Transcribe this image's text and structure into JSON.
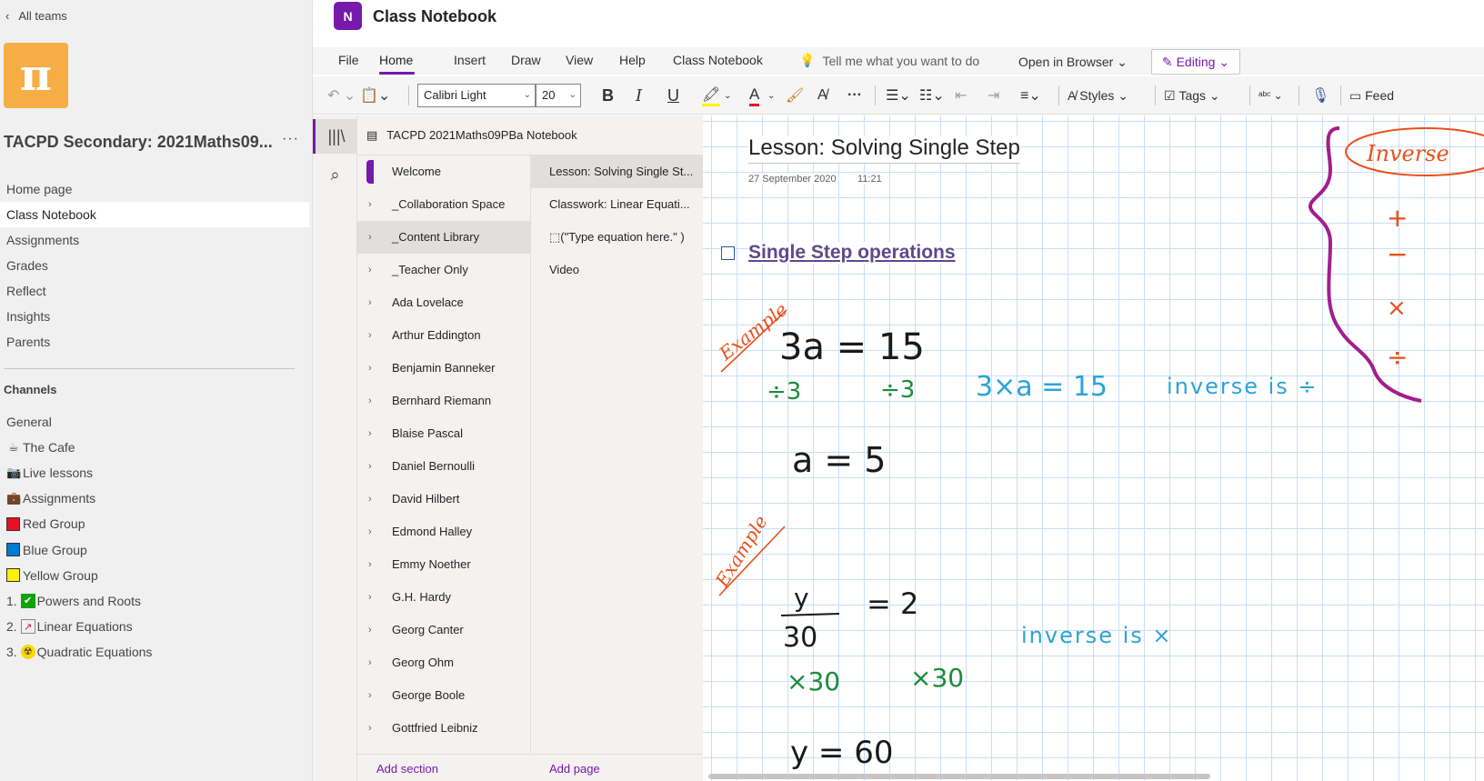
{
  "teams_pane": {
    "back_label": "All teams",
    "team_name": "TACPD Secondary: 2021Maths09...",
    "more": "···",
    "logo_symbol": "π",
    "nav": [
      "Home page",
      "Class Notebook",
      "Assignments",
      "Grades",
      "Reflect",
      "Insights",
      "Parents"
    ],
    "active_nav": "Class Notebook",
    "channels_heading": "Channels",
    "channels": [
      {
        "prefix": "",
        "icon": "",
        "label": "General"
      },
      {
        "prefix": "",
        "icon": "coffee-cup-icon",
        "label": "The Cafe"
      },
      {
        "prefix": "",
        "icon": "camera-icon",
        "label": "Live lessons"
      },
      {
        "prefix": "",
        "icon": "briefcase-icon",
        "label": "Assignments"
      },
      {
        "prefix": "",
        "icon": "red-square-icon",
        "label": "Red Group",
        "color": "#e81123"
      },
      {
        "prefix": "",
        "icon": "blue-square-icon",
        "label": "Blue Group",
        "color": "#0078d4"
      },
      {
        "prefix": "",
        "icon": "yellow-square-icon",
        "label": "Yellow Group",
        "color": "#fff100"
      },
      {
        "prefix": "1.",
        "icon": "check-box-icon",
        "label": "Powers and Roots"
      },
      {
        "prefix": "2.",
        "icon": "chart-icon",
        "label": "Linear Equations"
      },
      {
        "prefix": "3.",
        "icon": "radioactive-icon",
        "label": "Quadratic Equations"
      }
    ]
  },
  "header": {
    "app_title": "Class Notebook",
    "logo_text": "N"
  },
  "ribbon": {
    "tabs": [
      "File",
      "Home",
      "Insert",
      "Draw",
      "View",
      "Help",
      "Class Notebook"
    ],
    "active_tab": "Home",
    "tell_me": "Tell me what you want to do",
    "open_browser": "Open in Browser",
    "editing": "Editing",
    "font_name": "Calibri Light",
    "font_size": "20",
    "styles": "Styles",
    "tags": "Tags",
    "feed": "Feed"
  },
  "notebook": {
    "title": "TACPD 2021Maths09PBa Notebook",
    "sections": [
      "Welcome",
      "_Collaboration Space",
      "_Content Library",
      "_Teacher Only",
      "Ada Lovelace",
      "Arthur Eddington",
      "Benjamin Banneker",
      "Bernhard Riemann",
      "Blaise Pascal",
      "Daniel Bernoulli",
      "David Hilbert",
      "Edmond Halley",
      "Emmy Noether",
      "G.H. Hardy",
      "Georg Canter",
      "Georg Ohm",
      "George Boole",
      "Gottfried Leibniz"
    ],
    "pages": [
      "Lesson: Solving Single St...",
      "Classwork: Linear Equati...",
      "⬚(\"Type equation here.\" )",
      "Video"
    ],
    "add_section": "Add section",
    "add_page": "Add page"
  },
  "page": {
    "title": "Lesson: Solving Single Step",
    "date": "27 September 2020",
    "time": "11:21",
    "heading": "Single Step operations",
    "ink": {
      "example_label": "Example",
      "eq1": "3a = 15",
      "div1": "÷3",
      "div2": "÷3",
      "note1": "3×a = 15",
      "note1_b": "inverse is ÷",
      "eq1_result": "a = 5",
      "eq2_num": "y",
      "eq2_den": "30",
      "eq2_rhs": "= 2",
      "note2": "inverse is ×",
      "mul1": "×30",
      "mul2": "×30",
      "eq2_result": "y = 60",
      "inverse_title": "Inverse",
      "inv_plus": "+",
      "inv_minus": "−",
      "inv_times": "×",
      "inv_div": "÷"
    },
    "colors": {
      "black": "#1a1a1a",
      "green": "#1d8b3a",
      "blue": "#2ba3d9",
      "orange": "#e8501a",
      "purple": "#a11f8c"
    }
  }
}
